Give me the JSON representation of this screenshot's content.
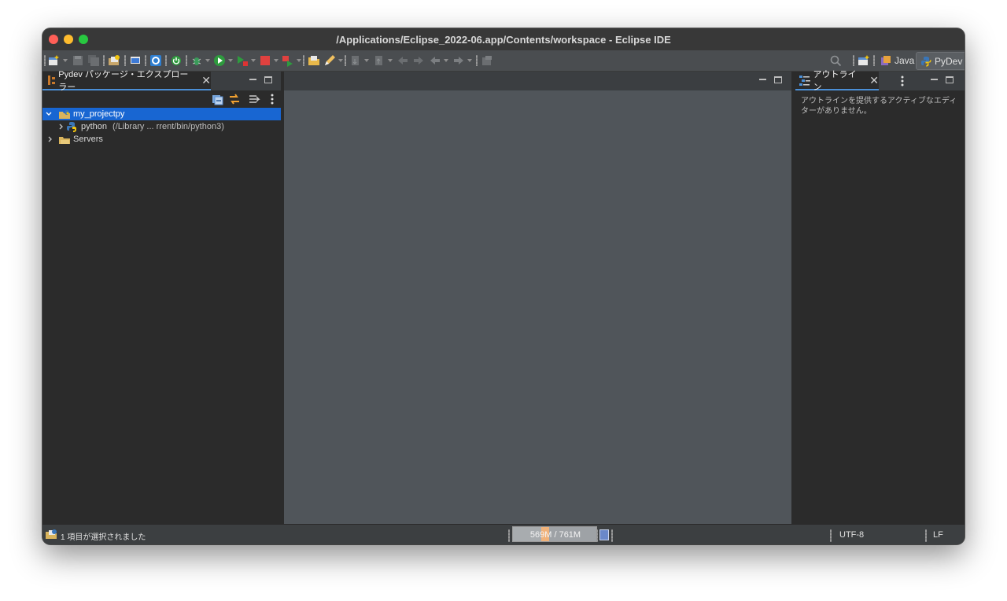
{
  "window": {
    "title": "/Applications/Eclipse_2022-06.app/Contents/workspace - Eclipse IDE"
  },
  "toolbar": {
    "perspectives": [
      {
        "label": "Java",
        "icon": "java-perspective-icon",
        "active": false
      },
      {
        "label": "PyDev",
        "icon": "pydev-perspective-icon",
        "active": true
      }
    ]
  },
  "explorer": {
    "tab_label": "Pydev パッケージ・エクスプローラー",
    "tree": [
      {
        "label": "my_projectpy",
        "expanded": true,
        "selected": true,
        "icon": "pydev-project-icon"
      },
      {
        "label": "python",
        "detail": "(/Library ... rrent/bin/python3)",
        "expanded": false,
        "icon": "python-interpreter-icon"
      },
      {
        "label": "Servers",
        "expanded": false,
        "icon": "folder-icon"
      }
    ]
  },
  "outline": {
    "tab_label": "アウトライン",
    "message": "アウトラインを提供するアクティブなエディターがありません。"
  },
  "status": {
    "selection": "1 項目が選択されました",
    "heap": "569M / 761M",
    "encoding": "UTF-8",
    "line_delimiter": "LF"
  },
  "colors": {
    "selection": "#1866d2",
    "accent": "#4b8fd6"
  }
}
